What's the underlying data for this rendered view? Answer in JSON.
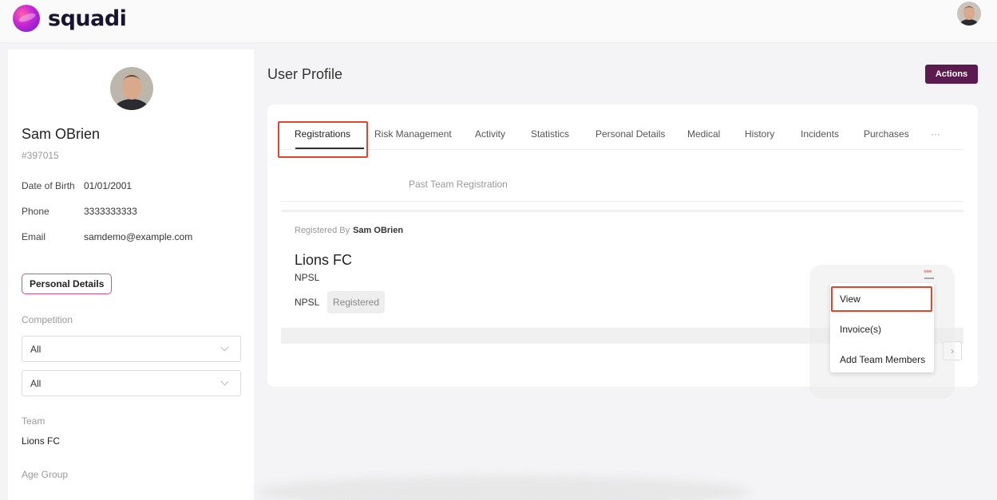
{
  "brand": {
    "name": "squadi"
  },
  "profile": {
    "name": "Sam OBrien",
    "id": "#397015",
    "dob_label": "Date of Birth",
    "dob": "01/01/2001",
    "phone_label": "Phone",
    "phone": "3333333333",
    "email_label": "Email",
    "email": "samdemo@example.com",
    "personal_details_button": "Personal Details",
    "competition_label": "Competition",
    "competition_value": "All",
    "second_filter_value": "All",
    "team_label": "Team",
    "team_value": "Lions FC",
    "age_group_label": "Age Group"
  },
  "page": {
    "title": "User Profile",
    "actions_button": "Actions"
  },
  "tabs": [
    {
      "label": "Registrations"
    },
    {
      "label": "Risk Management"
    },
    {
      "label": "Activity"
    },
    {
      "label": "Statistics"
    },
    {
      "label": "Personal Details"
    },
    {
      "label": "Medical"
    },
    {
      "label": "History"
    },
    {
      "label": "Incidents"
    },
    {
      "label": "Purchases"
    },
    {
      "label": "···"
    }
  ],
  "subtab": "Past Team Registration",
  "registration": {
    "registered_by_label": "Registered By",
    "registered_by": "Sam OBrien",
    "club": "Lions FC",
    "club_sub": "NPSL",
    "competition": "NPSL",
    "status": "Registered",
    "more_icon": "more-dots-icon"
  },
  "pagination": {
    "next": "›"
  },
  "menu": {
    "items": [
      {
        "label": "View"
      },
      {
        "label": "Invoice(s)"
      },
      {
        "label": "Add Team Members"
      }
    ]
  },
  "colors": {
    "accent": "#5b1b4e",
    "highlight": "#e2452a",
    "brand_pink": "#cf4ea0"
  }
}
